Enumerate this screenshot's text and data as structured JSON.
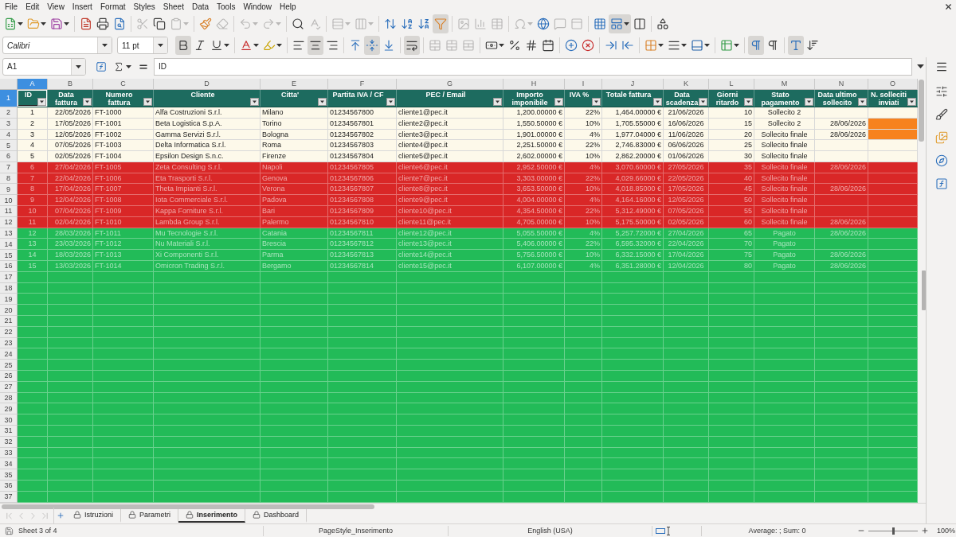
{
  "menu": [
    "File",
    "Edit",
    "View",
    "Insert",
    "Format",
    "Styles",
    "Sheet",
    "Data",
    "Tools",
    "Window",
    "Help"
  ],
  "standard_toolbar": {
    "groups": [
      [
        {
          "kind": "new",
          "dropdown": true,
          "pressed": false,
          "disabled": false
        },
        {
          "kind": "open",
          "dropdown": true,
          "pressed": false,
          "disabled": false
        },
        {
          "kind": "save",
          "dropdown": true,
          "pressed": false,
          "disabled": false
        }
      ],
      [
        {
          "kind": "export_pdf",
          "dropdown": false,
          "pressed": false,
          "disabled": false
        },
        {
          "kind": "print",
          "dropdown": false,
          "pressed": false,
          "disabled": false
        },
        {
          "kind": "print_preview",
          "dropdown": false,
          "pressed": false,
          "disabled": false
        }
      ],
      [
        {
          "kind": "cut",
          "dropdown": false,
          "pressed": false,
          "disabled": true
        },
        {
          "kind": "copy",
          "dropdown": false,
          "pressed": false,
          "disabled": false
        },
        {
          "kind": "paste",
          "dropdown": true,
          "pressed": false,
          "disabled": true
        }
      ],
      [
        {
          "kind": "clone_formatting",
          "dropdown": false,
          "pressed": false,
          "disabled": false
        },
        {
          "kind": "clear_formatting",
          "dropdown": false,
          "pressed": false,
          "disabled": true
        }
      ],
      [
        {
          "kind": "undo",
          "dropdown": true,
          "pressed": false,
          "disabled": true
        },
        {
          "kind": "redo",
          "dropdown": true,
          "pressed": false,
          "disabled": true
        }
      ],
      [
        {
          "kind": "find_replace",
          "dropdown": false,
          "pressed": false,
          "disabled": false
        },
        {
          "kind": "spelling",
          "dropdown": false,
          "pressed": false,
          "disabled": true
        }
      ],
      [
        {
          "kind": "row",
          "dropdown": true,
          "pressed": false,
          "disabled": true
        },
        {
          "kind": "column",
          "dropdown": true,
          "pressed": false,
          "disabled": true
        }
      ],
      [
        {
          "kind": "sort",
          "dropdown": false,
          "pressed": false,
          "disabled": false
        },
        {
          "kind": "sort_ascending",
          "dropdown": false,
          "pressed": false,
          "disabled": false
        },
        {
          "kind": "sort_descending",
          "dropdown": false,
          "pressed": false,
          "disabled": false
        },
        {
          "kind": "autofilter",
          "dropdown": false,
          "pressed": true,
          "disabled": false
        }
      ],
      [
        {
          "kind": "image",
          "dropdown": false,
          "pressed": false,
          "disabled": true
        },
        {
          "kind": "chart",
          "dropdown": false,
          "pressed": false,
          "disabled": true
        },
        {
          "kind": "pivot_table",
          "dropdown": false,
          "pressed": false,
          "disabled": true
        }
      ],
      [
        {
          "kind": "special_character",
          "dropdown": true,
          "pressed": false,
          "disabled": true
        },
        {
          "kind": "hyperlink",
          "dropdown": false,
          "pressed": false,
          "disabled": false
        },
        {
          "kind": "comment",
          "dropdown": false,
          "pressed": false,
          "disabled": true
        },
        {
          "kind": "header_footer",
          "dropdown": false,
          "pressed": false,
          "disabled": true
        }
      ],
      [
        {
          "kind": "print_area",
          "dropdown": false,
          "pressed": false,
          "disabled": false
        },
        {
          "kind": "freeze",
          "dropdown": true,
          "pressed": true,
          "disabled": false
        },
        {
          "kind": "split_window",
          "dropdown": false,
          "pressed": false,
          "disabled": false
        }
      ],
      [
        {
          "kind": "draw_functions",
          "dropdown": false,
          "pressed": false,
          "disabled": false
        }
      ]
    ]
  },
  "formatting_toolbar": {
    "font_name": "Calibri",
    "font_size": "11 pt",
    "groups": [
      [
        {
          "kind": "bold",
          "dropdown": false,
          "pressed": true,
          "disabled": false
        },
        {
          "kind": "italic",
          "dropdown": false,
          "pressed": false,
          "disabled": false
        },
        {
          "kind": "underline",
          "dropdown": true,
          "pressed": false,
          "disabled": false
        }
      ],
      [
        {
          "kind": "font_color",
          "dropdown": true,
          "pressed": false,
          "disabled": false
        },
        {
          "kind": "highlighting",
          "dropdown": true,
          "pressed": false,
          "disabled": false
        }
      ],
      [
        {
          "kind": "align_left",
          "dropdown": false,
          "pressed": false,
          "disabled": false
        },
        {
          "kind": "align_center",
          "dropdown": false,
          "pressed": true,
          "disabled": false
        },
        {
          "kind": "align_right",
          "dropdown": false,
          "pressed": false,
          "disabled": false
        }
      ],
      [
        {
          "kind": "align_top",
          "dropdown": false,
          "pressed": false,
          "disabled": false
        },
        {
          "kind": "align_middle",
          "dropdown": false,
          "pressed": true,
          "disabled": false
        },
        {
          "kind": "align_bottom",
          "dropdown": false,
          "pressed": false,
          "disabled": false
        }
      ],
      [
        {
          "kind": "wrap_text",
          "dropdown": false,
          "pressed": true,
          "disabled": false
        }
      ],
      [
        {
          "kind": "merge_center",
          "dropdown": false,
          "pressed": false,
          "disabled": true
        },
        {
          "kind": "merge",
          "dropdown": false,
          "pressed": false,
          "disabled": true
        },
        {
          "kind": "unmerge",
          "dropdown": false,
          "pressed": false,
          "disabled": true
        }
      ],
      [
        {
          "kind": "currency",
          "dropdown": true,
          "pressed": false,
          "disabled": false
        },
        {
          "kind": "percent",
          "dropdown": false,
          "pressed": false,
          "disabled": false
        },
        {
          "kind": "standard_number",
          "dropdown": false,
          "pressed": false,
          "disabled": false
        },
        {
          "kind": "date",
          "dropdown": false,
          "pressed": false,
          "disabled": false
        }
      ],
      [
        {
          "kind": "add_decimal",
          "dropdown": false,
          "pressed": false,
          "disabled": false
        },
        {
          "kind": "delete_decimal",
          "dropdown": false,
          "pressed": false,
          "disabled": false
        }
      ],
      [
        {
          "kind": "increase_indent",
          "dropdown": false,
          "pressed": false,
          "disabled": false
        },
        {
          "kind": "decrease_indent",
          "dropdown": false,
          "pressed": false,
          "disabled": false
        }
      ],
      [
        {
          "kind": "borders",
          "dropdown": true,
          "pressed": false,
          "disabled": false
        },
        {
          "kind": "border_style",
          "dropdown": true,
          "pressed": false,
          "disabled": false
        },
        {
          "kind": "border_color",
          "dropdown": true,
          "pressed": false,
          "disabled": false
        }
      ],
      [
        {
          "kind": "conditional",
          "dropdown": true,
          "pressed": false,
          "disabled": false
        }
      ],
      [
        {
          "kind": "left_to_right",
          "dropdown": false,
          "pressed": true,
          "disabled": false
        },
        {
          "kind": "right_to_left",
          "dropdown": false,
          "pressed": false,
          "disabled": false
        }
      ],
      [
        {
          "kind": "text_horizontal",
          "dropdown": false,
          "pressed": true,
          "disabled": false
        },
        {
          "kind": "text_vertical",
          "dropdown": false,
          "pressed": false,
          "disabled": false
        }
      ]
    ]
  },
  "formula_bar": {
    "cell_reference": "A1",
    "content": "ID"
  },
  "sheet": {
    "columns": [
      {
        "letter": "A",
        "header": "ID",
        "selected": true
      },
      {
        "letter": "B",
        "header": "Data fattura",
        "selected": false
      },
      {
        "letter": "C",
        "header": "Numero fattura",
        "selected": false
      },
      {
        "letter": "D",
        "header": "Cliente",
        "selected": false
      },
      {
        "letter": "E",
        "header": "Citta'",
        "selected": false
      },
      {
        "letter": "F",
        "header": "Partita IVA / CF",
        "selected": false
      },
      {
        "letter": "G",
        "header": "PEC / Email",
        "selected": false
      },
      {
        "letter": "H",
        "header": "Importo imponibile",
        "selected": false
      },
      {
        "letter": "I",
        "header": "IVA %",
        "selected": false
      },
      {
        "letter": "J",
        "header": "Totale fattura",
        "selected": false
      },
      {
        "letter": "K",
        "header": "Data scadenza",
        "selected": false
      },
      {
        "letter": "L",
        "header": "Giorni ritardo",
        "selected": false
      },
      {
        "letter": "M",
        "header": "Stato pagamento",
        "selected": false
      },
      {
        "letter": "N",
        "header": "Data ultimo sollecito",
        "selected": false
      },
      {
        "letter": "O",
        "header": "N. solleciti inviati",
        "selected": false
      }
    ],
    "header_row": {
      "number": "1",
      "selected": true
    },
    "rows": [
      {
        "number": "2",
        "selected": false,
        "color": "#fdf9ea",
        "reminders_highlighted": false,
        "cells": [
          "1",
          "22/05/2026",
          "FT-1000",
          "Alfa Costruzioni S.r.l.",
          "Milano",
          "01234567800",
          "cliente1@pec.it",
          "1,200.00000 €",
          "22%",
          "1,464.00000 €",
          "21/06/2026",
          "10",
          "Sollecito 2"
        ]
      },
      {
        "number": "3",
        "selected": false,
        "color": "#fdf9ea",
        "reminders_highlighted": true,
        "cells": [
          "2",
          "17/05/2026",
          "FT-1001",
          "Beta Logistica S.p.A.",
          "Torino",
          "01234567801",
          "cliente2@pec.it",
          "1,550.50000 €",
          "10%",
          "1,705.55000 €",
          "16/06/2026",
          "15",
          "Sollecito 2"
        ],
        "last_reminder": "28/06/2026"
      },
      {
        "number": "4",
        "selected": false,
        "color": "#fdf9ea",
        "reminders_highlighted": true,
        "cells": [
          "3",
          "12/05/2026",
          "FT-1002",
          "Gamma Servizi S.r.l.",
          "Bologna",
          "01234567802",
          "cliente3@pec.it",
          "1,901.00000 €",
          "4%",
          "1,977.04000 €",
          "11/06/2026",
          "20",
          "Sollecito finale"
        ],
        "last_reminder": "28/06/2026"
      },
      {
        "number": "5",
        "selected": false,
        "color": "#fdf9ea",
        "reminders_highlighted": false,
        "cells": [
          "4",
          "07/05/2026",
          "FT-1003",
          "Delta Informatica S.r.l.",
          "Roma",
          "01234567803",
          "cliente4@pec.it",
          "2,251.50000 €",
          "22%",
          "2,746.83000 €",
          "06/06/2026",
          "25",
          "Sollecito finale"
        ]
      },
      {
        "number": "6",
        "selected": false,
        "color": "#fdf9ea",
        "reminders_highlighted": false,
        "cells": [
          "5",
          "02/05/2026",
          "FT-1004",
          "Epsilon Design S.n.c.",
          "Firenze",
          "01234567804",
          "cliente5@pec.it",
          "2,602.00000 €",
          "10%",
          "2,862.20000 €",
          "01/06/2026",
          "30",
          "Sollecito finale"
        ]
      },
      {
        "number": "7",
        "selected": false,
        "color": "#d92727",
        "reminders_highlighted": false,
        "cells": [
          "6",
          "27/04/2026",
          "FT-1005",
          "Zeta Consulting S.r.l.",
          "Napoli",
          "01234567805",
          "cliente6@pec.it",
          "2,952.50000 €",
          "4%",
          "3,070.60000 €",
          "27/05/2026",
          "35",
          "Sollecito finale"
        ],
        "last_reminder": "28/06/2026"
      },
      {
        "number": "8",
        "selected": false,
        "color": "#d92727",
        "reminders_highlighted": false,
        "cells": [
          "7",
          "22/04/2026",
          "FT-1006",
          "Eta Trasporti S.r.l.",
          "Genova",
          "01234567806",
          "cliente7@pec.it",
          "3,303.00000 €",
          "22%",
          "4,029.66000 €",
          "22/05/2026",
          "40",
          "Sollecito finale"
        ]
      },
      {
        "number": "9",
        "selected": false,
        "color": "#d92727",
        "reminders_highlighted": false,
        "cells": [
          "8",
          "17/04/2026",
          "FT-1007",
          "Theta Impianti S.r.l.",
          "Verona",
          "01234567807",
          "cliente8@pec.it",
          "3,653.50000 €",
          "10%",
          "4,018.85000 €",
          "17/05/2026",
          "45",
          "Sollecito finale"
        ],
        "last_reminder": "28/06/2026"
      },
      {
        "number": "10",
        "selected": false,
        "color": "#d92727",
        "reminders_highlighted": false,
        "cells": [
          "9",
          "12/04/2026",
          "FT-1008",
          "Iota Commerciale S.r.l.",
          "Padova",
          "01234567808",
          "cliente9@pec.it",
          "4,004.00000 €",
          "4%",
          "4,164.16000 €",
          "12/05/2026",
          "50",
          "Sollecito finale"
        ]
      },
      {
        "number": "11",
        "selected": false,
        "color": "#d92727",
        "reminders_highlighted": false,
        "cells": [
          "10",
          "07/04/2026",
          "FT-1009",
          "Kappa Forniture S.r.l.",
          "Bari",
          "01234567809",
          "cliente10@pec.it",
          "4,354.50000 €",
          "22%",
          "5,312.49000 €",
          "07/05/2026",
          "55",
          "Sollecito finale"
        ]
      },
      {
        "number": "12",
        "selected": false,
        "color": "#d92727",
        "reminders_highlighted": false,
        "cells": [
          "11",
          "02/04/2026",
          "FT-1010",
          "Lambda Group S.r.l.",
          "Palermo",
          "01234567810",
          "cliente11@pec.it",
          "4,705.00000 €",
          "10%",
          "5,175.50000 €",
          "02/05/2026",
          "60",
          "Sollecito finale"
        ],
        "last_reminder": "28/06/2026"
      },
      {
        "number": "13",
        "selected": false,
        "color": "#22bb58",
        "reminders_highlighted": false,
        "cells": [
          "12",
          "28/03/2026",
          "FT-1011",
          "Mu Tecnologie S.r.l.",
          "Catania",
          "01234567811",
          "cliente12@pec.it",
          "5,055.50000 €",
          "4%",
          "5,257.72000 €",
          "27/04/2026",
          "65",
          "Pagato"
        ],
        "last_reminder": "28/06/2026"
      },
      {
        "number": "14",
        "selected": false,
        "color": "#22bb58",
        "reminders_highlighted": false,
        "cells": [
          "13",
          "23/03/2026",
          "FT-1012",
          "Nu Materiali S.r.l.",
          "Brescia",
          "01234567812",
          "cliente13@pec.it",
          "5,406.00000 €",
          "22%",
          "6,595.32000 €",
          "22/04/2026",
          "70",
          "Pagato"
        ]
      },
      {
        "number": "15",
        "selected": false,
        "color": "#22bb58",
        "reminders_highlighted": false,
        "cells": [
          "14",
          "18/03/2026",
          "FT-1013",
          "Xi Componenti S.r.l.",
          "Parma",
          "01234567813",
          "cliente14@pec.it",
          "5,756.50000 €",
          "10%",
          "6,332.15000 €",
          "17/04/2026",
          "75",
          "Pagato"
        ],
        "last_reminder": "28/06/2026"
      },
      {
        "number": "16",
        "selected": false,
        "color": "#22bb58",
        "reminders_highlighted": false,
        "cells": [
          "15",
          "13/03/2026",
          "FT-1014",
          "Omicron Trading S.r.l.",
          "Bergamo",
          "01234567814",
          "cliente15@pec.it",
          "6,107.00000 €",
          "4%",
          "6,351.28000 €",
          "12/04/2026",
          "80",
          "Pagato"
        ],
        "last_reminder": "28/06/2026"
      },
      {
        "number": "17",
        "selected": false,
        "color": "#22bb58",
        "reminders_highlighted": false
      },
      {
        "number": "18",
        "selected": false,
        "color": "#22bb58",
        "reminders_highlighted": false
      },
      {
        "number": "19",
        "selected": false,
        "color": "#22bb58",
        "reminders_highlighted": false
      },
      {
        "number": "20",
        "selected": false,
        "color": "#22bb58",
        "reminders_highlighted": false
      },
      {
        "number": "21",
        "selected": false,
        "color": "#22bb58",
        "reminders_highlighted": false
      },
      {
        "number": "22",
        "selected": false,
        "color": "#22bb58",
        "reminders_highlighted": false
      },
      {
        "number": "23",
        "selected": false,
        "color": "#22bb58",
        "reminders_highlighted": false
      },
      {
        "number": "24",
        "selected": false,
        "color": "#22bb58",
        "reminders_highlighted": false
      },
      {
        "number": "25",
        "selected": false,
        "color": "#22bb58",
        "reminders_highlighted": false
      },
      {
        "number": "26",
        "selected": false,
        "color": "#22bb58",
        "reminders_highlighted": false
      },
      {
        "number": "27",
        "selected": false,
        "color": "#22bb58",
        "reminders_highlighted": false
      },
      {
        "number": "28",
        "selected": false,
        "color": "#22bb58",
        "reminders_highlighted": false
      },
      {
        "number": "29",
        "selected": false,
        "color": "#22bb58",
        "reminders_highlighted": false
      },
      {
        "number": "30",
        "selected": false,
        "color": "#22bb58",
        "reminders_highlighted": false
      },
      {
        "number": "31",
        "selected": false,
        "color": "#22bb58",
        "reminders_highlighted": false
      },
      {
        "number": "32",
        "selected": false,
        "color": "#22bb58",
        "reminders_highlighted": false
      },
      {
        "number": "33",
        "selected": false,
        "color": "#22bb58",
        "reminders_highlighted": false
      },
      {
        "number": "34",
        "selected": false,
        "color": "#22bb58",
        "reminders_highlighted": false
      },
      {
        "number": "35",
        "selected": false,
        "color": "#22bb58",
        "reminders_highlighted": false
      },
      {
        "number": "36",
        "selected": false,
        "color": "#22bb58",
        "reminders_highlighted": false
      },
      {
        "number": "37",
        "selected": false,
        "color": "#22bb58",
        "reminders_highlighted": false
      }
    ]
  },
  "sheet_navigation": [
    {
      "kind": "first",
      "disabled": true
    },
    {
      "kind": "previous",
      "disabled": true
    },
    {
      "kind": "next",
      "disabled": true
    },
    {
      "kind": "last",
      "disabled": true
    }
  ],
  "sheet_tabs": [
    {
      "label": "Istruzioni",
      "selected": false
    },
    {
      "label": "Parametri",
      "selected": false
    },
    {
      "label": "Inserimento",
      "selected": true
    },
    {
      "label": "Dashboard",
      "selected": false
    }
  ],
  "status_bar": {
    "sheet_position": "Sheet 3 of 4",
    "page_style": "PageStyle_Inserimento",
    "language": "English (USA)",
    "selection_summary": "Average: ; Sum: 0",
    "zoom_slider": {
      "level": 0.5
    },
    "zoom": "100%"
  }
}
